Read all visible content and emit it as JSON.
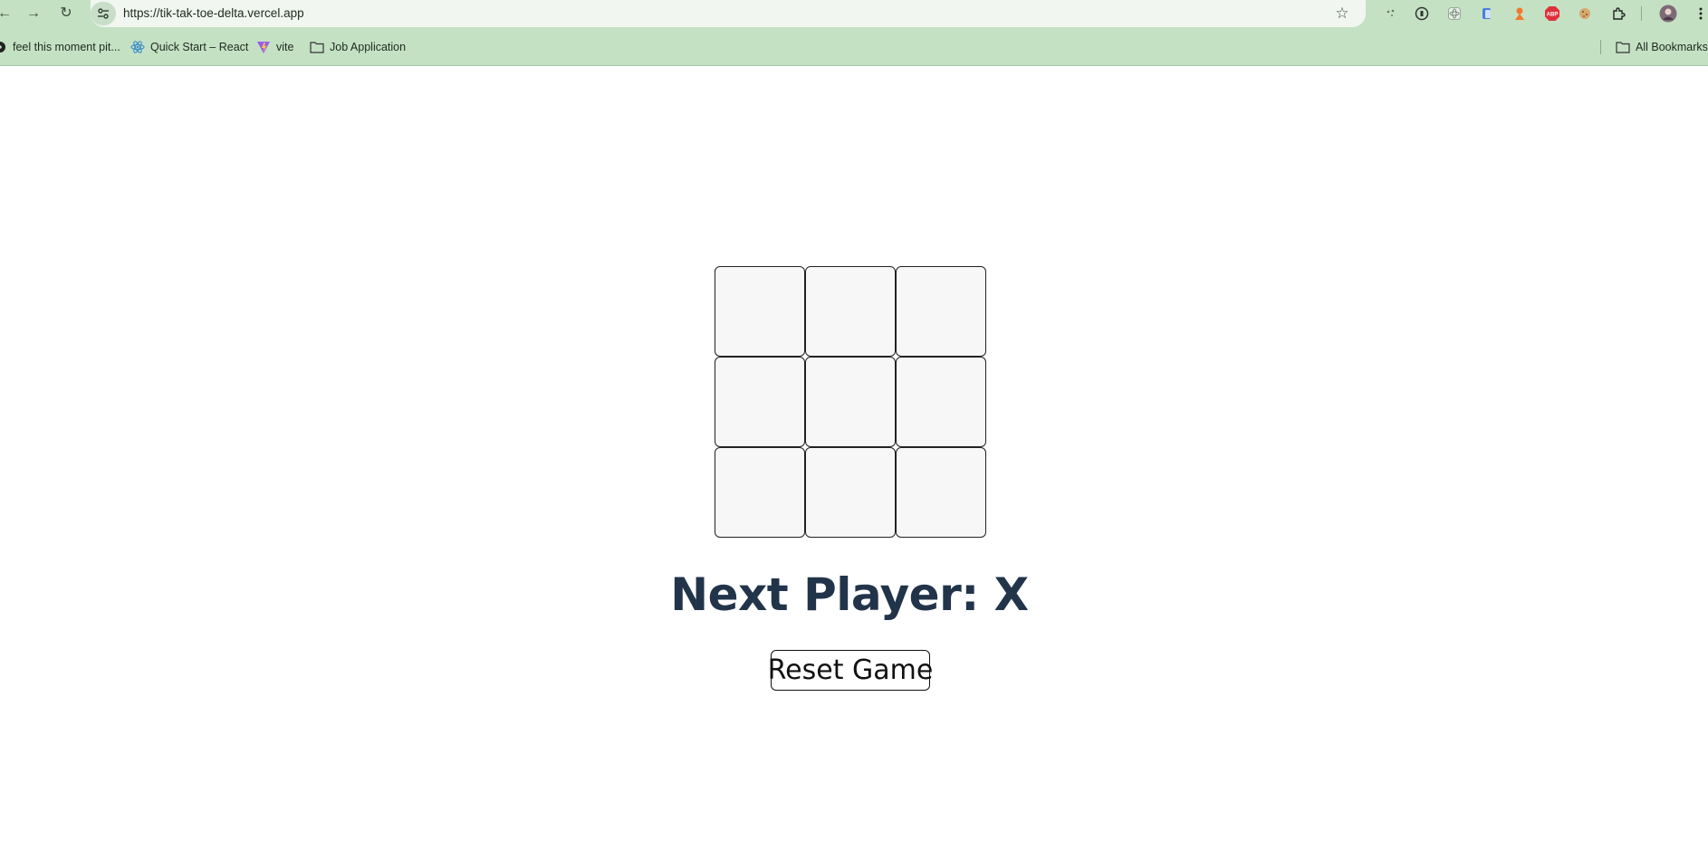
{
  "browser": {
    "url": "https://tik-tak-toe-delta.vercel.app",
    "bookmarks": [
      {
        "label": "feel this moment pit...",
        "icon": "music-disc-icon"
      },
      {
        "label": "Quick Start – React",
        "icon": "react-icon"
      },
      {
        "label": "vite",
        "icon": "vite-icon"
      },
      {
        "label": "Job Application",
        "icon": "folder-icon"
      }
    ],
    "all_bookmarks_label": "All Bookmarks",
    "extensions": [
      "extension-spark-icon",
      "extension-password-icon",
      "extension-react-devtools-icon",
      "extension-copy-icon",
      "extension-character-icon",
      "extension-adblock-icon",
      "extension-cookie-icon",
      "extensions-puzzle-icon"
    ],
    "colors": {
      "chrome_green": "#c4e1c4",
      "omnibox": "#f1f6f1"
    }
  },
  "game": {
    "squares": [
      "",
      "",
      "",
      "",
      "",
      "",
      "",
      "",
      ""
    ],
    "status": "Next Player: X",
    "reset_label": "Reset Game",
    "colors": {
      "status_text": "#22344a",
      "square_bg": "#f7f7f7"
    }
  }
}
